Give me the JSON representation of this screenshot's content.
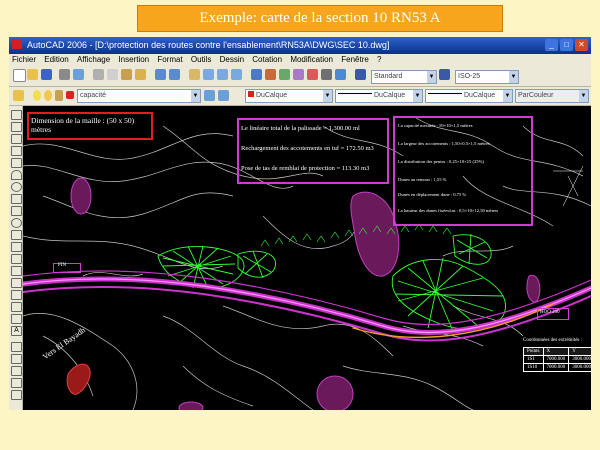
{
  "slide": {
    "title": "Exemple: carte de la section 10 RN53 A"
  },
  "window": {
    "title": "AutoCAD 2006 - [D:\\protection des routes contre l'ensablement\\RN53A\\DWG\\SEC 10.dwg]"
  },
  "menu": [
    "Fichier",
    "Edition",
    "Affichage",
    "Insertion",
    "Format",
    "Outils",
    "Dessin",
    "Cotation",
    "Modification",
    "Fenêtre",
    "?"
  ],
  "toolbar": {
    "text_style": "Standard",
    "dim_style": "ISO-25",
    "layer": "capacité",
    "color": "DuCalque",
    "linetype": "DuCalque",
    "lineweight": "DuCalque",
    "plotstyle": "ParCouleur"
  },
  "drawing": {
    "mesh_note": "Dimension de la maille : (50 x 50) mètres",
    "summary": [
      "Le linéaire total de la palissade = 1,300.00 ml",
      "Rechargement des accotements en tuf = 172.50 m3",
      "Pose de tas de remblai de protection = 113.30 m3"
    ],
    "params": [
      "La capacité mesurée : 59×10×1,5 mètres",
      "La largeur des accotements : 1,50×0,5×1,5 mètres",
      "La distribution des pentes : 0,25×10×15 (25%)",
      "Dunes au remous : 1,55 %",
      "Dunes en déplacement dune : 0,75 %",
      "La hauteur des dunes fixées/tas : 0,5×10×12,50 mètres"
    ],
    "labels": {
      "pk_left": "FIN",
      "road": "Vers El Bayadh",
      "pk_right": "HOO 200",
      "table_caption": "Coordonnées des extrémités :"
    },
    "table_headers": [
      "Points",
      "X",
      "Y"
    ],
    "table_rows": [
      [
        "1S1",
        "7000.000",
        "3000.000"
      ],
      [
        "1S10",
        "7000.000",
        "3000.000"
      ]
    ]
  }
}
